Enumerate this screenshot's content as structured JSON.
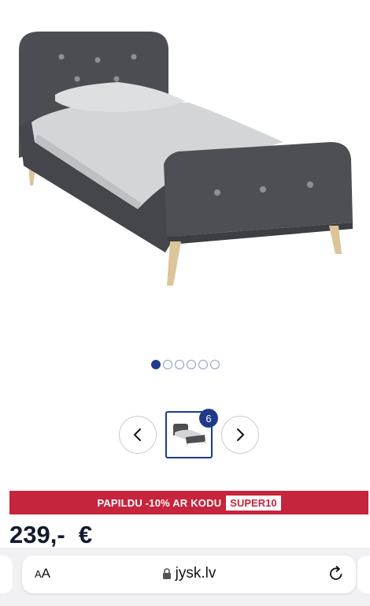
{
  "gallery": {
    "image_alt": "Upholstered single bed",
    "dots_total": 6,
    "active_index": 0
  },
  "thumbnails": {
    "count_badge": "6"
  },
  "promo": {
    "text": "PAPILDU -10% AR KODU",
    "code": "SUPER10"
  },
  "price": {
    "amount": "239,-  €"
  },
  "browser": {
    "aa_small": "A",
    "aa_large": "A",
    "url": "jysk.lv"
  },
  "colors": {
    "brand_blue": "#1d3a8c",
    "promo_red": "#c7243d",
    "bed_fabric": "#4a4c52",
    "bedding": "#d6d7d9",
    "legs": "#dcc59a"
  }
}
